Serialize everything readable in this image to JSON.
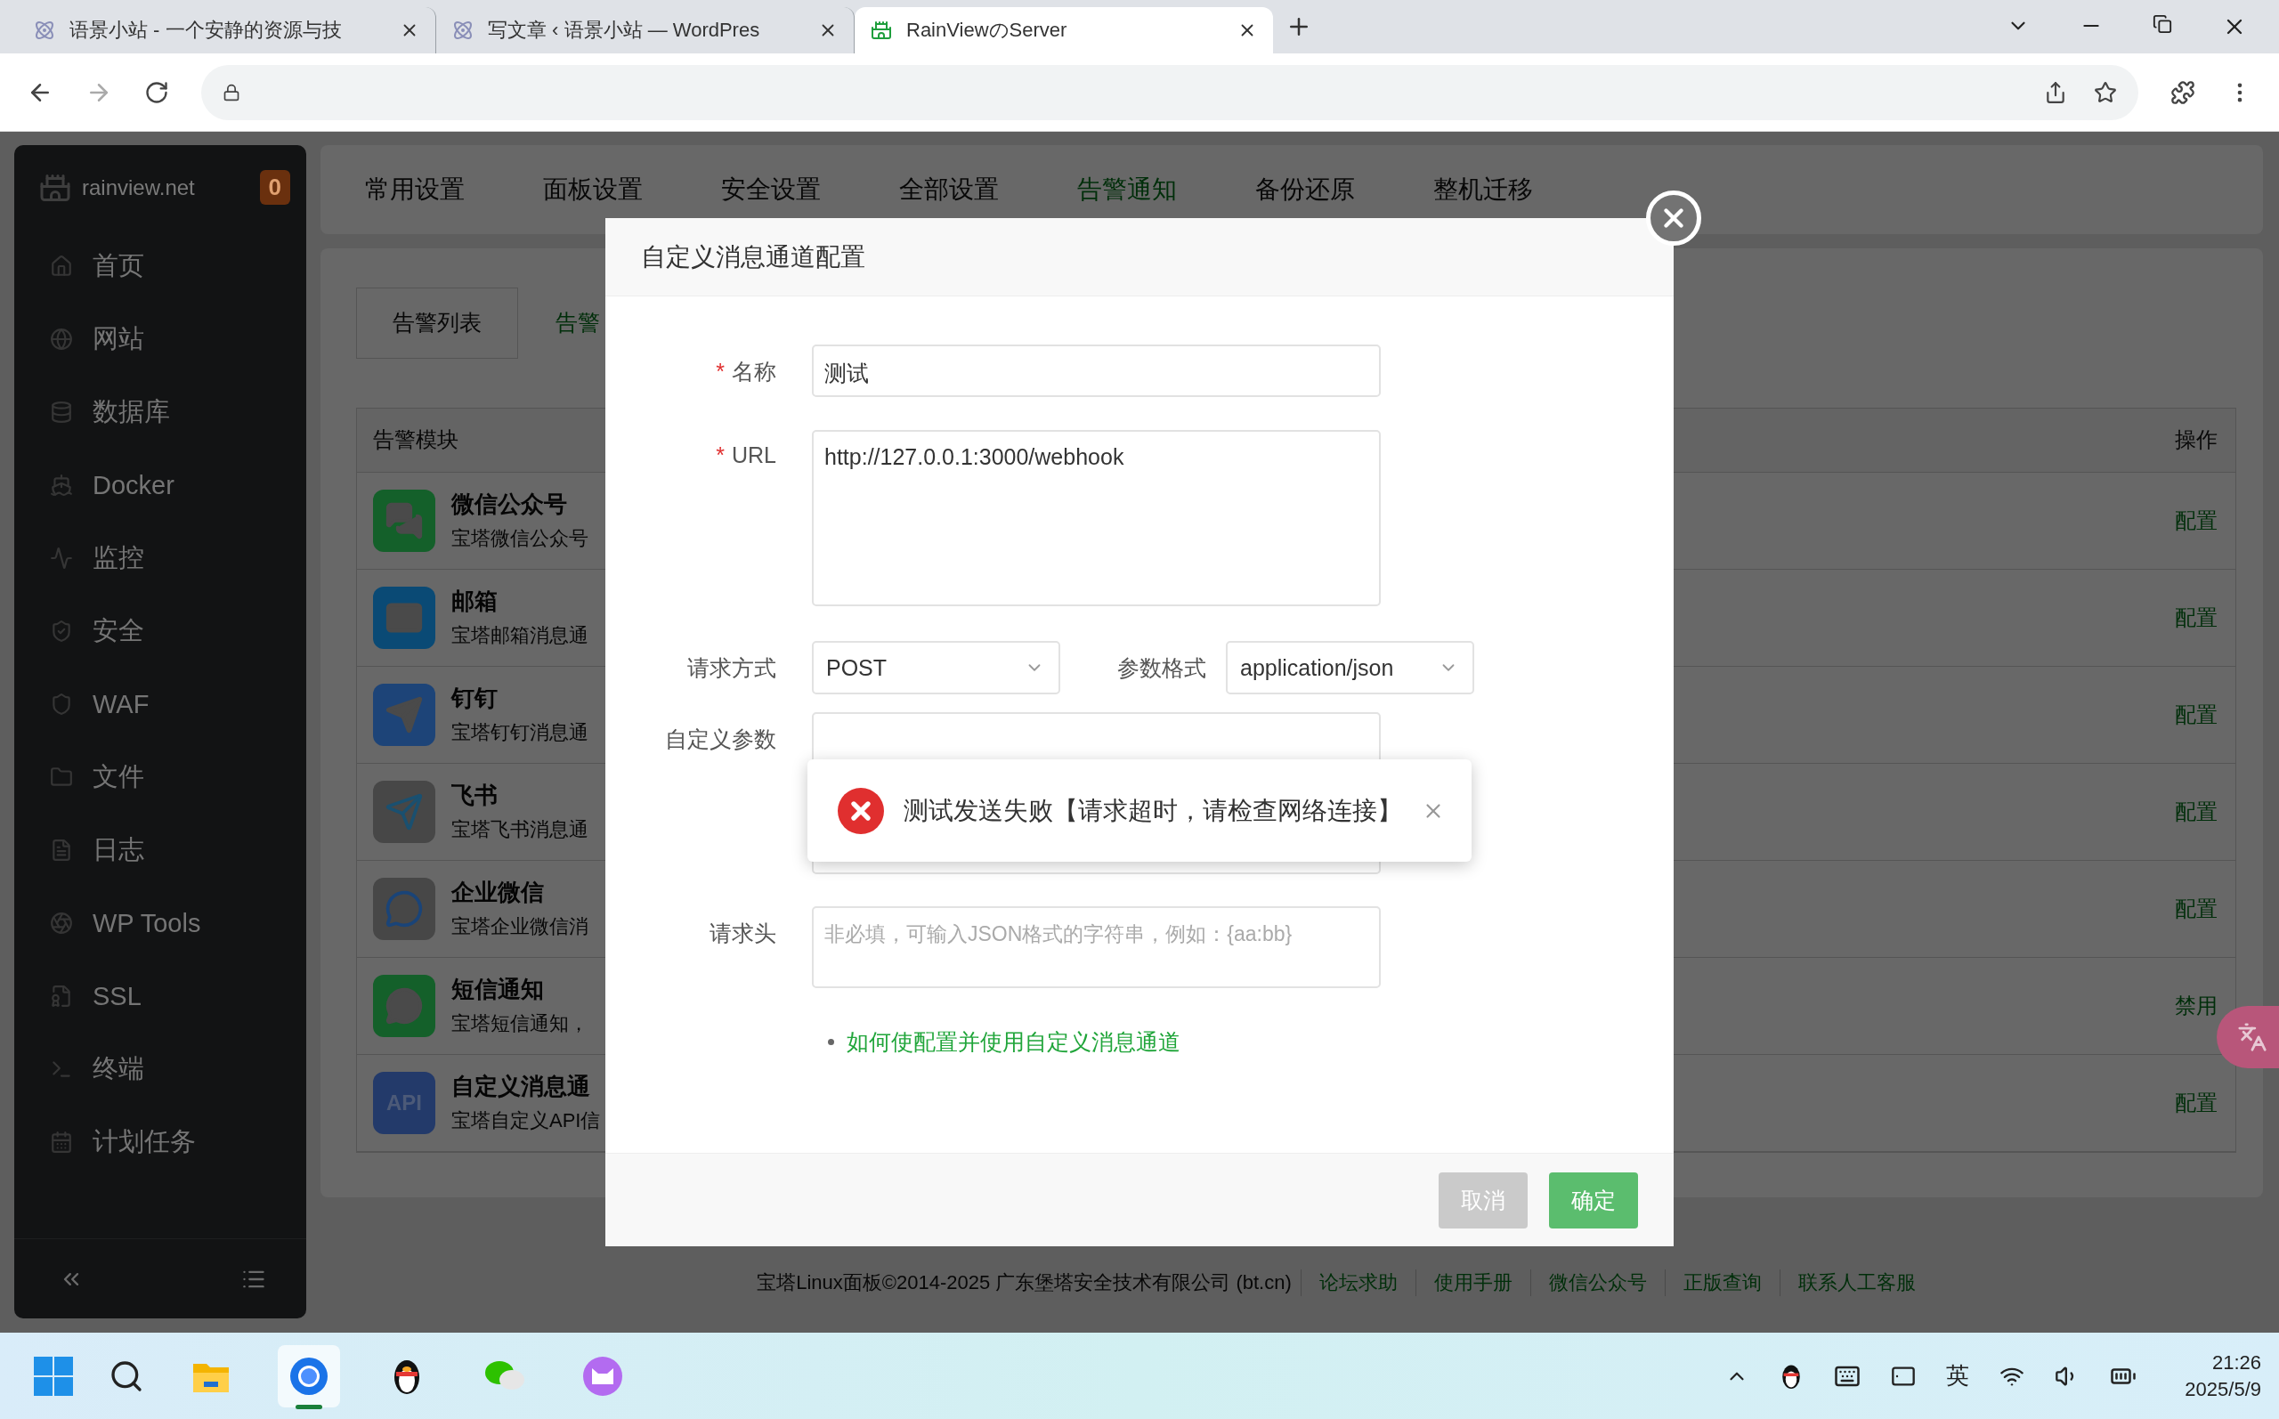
{
  "browser": {
    "tabs": [
      {
        "title": "语景小站 - 一个安静的资源与技",
        "selected": false
      },
      {
        "title": "写文章 ‹ 语景小站 — WordPres",
        "selected": false
      },
      {
        "title": "RainViewのServer",
        "selected": true
      }
    ]
  },
  "sidebar": {
    "brand": "rainview.net",
    "badge": "0",
    "items": [
      {
        "label": "首页"
      },
      {
        "label": "网站"
      },
      {
        "label": "数据库"
      },
      {
        "label": "Docker"
      },
      {
        "label": "监控"
      },
      {
        "label": "安全"
      },
      {
        "label": "WAF"
      },
      {
        "label": "文件"
      },
      {
        "label": "日志"
      },
      {
        "label": "WP Tools"
      },
      {
        "label": "SSL"
      },
      {
        "label": "终端"
      },
      {
        "label": "计划任务"
      }
    ]
  },
  "settings_tabs": [
    {
      "label": "常用设置",
      "selected": false
    },
    {
      "label": "面板设置",
      "selected": false
    },
    {
      "label": "安全设置",
      "selected": false
    },
    {
      "label": "全部设置",
      "selected": false
    },
    {
      "label": "告警通知",
      "selected": true
    },
    {
      "label": "备份还原",
      "selected": false
    },
    {
      "label": "整机迁移",
      "selected": false
    }
  ],
  "alert_tabs": [
    {
      "label": "告警列表",
      "selected": false
    },
    {
      "label": "告警",
      "selected": true
    }
  ],
  "alert_table": {
    "columns": [
      "告警模块",
      "操作"
    ],
    "rows": [
      {
        "title": "微信公众号",
        "description": "宝塔微信公众号",
        "action": "配置"
      },
      {
        "title": "邮箱",
        "description": "宝塔邮箱消息通",
        "action": "配置"
      },
      {
        "title": "钉钉",
        "description": "宝塔钉钉消息通",
        "action": "配置"
      },
      {
        "title": "飞书",
        "description": "宝塔飞书消息通",
        "action": "配置"
      },
      {
        "title": "企业微信",
        "description": "宝塔企业微信消",
        "action": "配置"
      },
      {
        "title": "短信通知",
        "description": "宝塔短信通知，",
        "action": "禁用"
      },
      {
        "title": "自定义消息通",
        "description": "宝塔自定义API信",
        "action": "配置",
        "icon_text": "API"
      }
    ]
  },
  "footer": {
    "copyright": "宝塔Linux面板©2014-2025 广东堡塔安全技术有限公司 (bt.cn)",
    "links": [
      "论坛求助",
      "使用手册",
      "微信公众号",
      "正版查询",
      "联系人工客服"
    ]
  },
  "modal": {
    "title": "自定义消息通道配置",
    "fields": [
      {
        "kind": "text",
        "label": "名称",
        "required_mark": "*",
        "value": "测试"
      },
      {
        "kind": "textarea",
        "label": "URL",
        "required_mark": "*",
        "value": "http://127.0.0.1:3000/webhook"
      },
      {
        "kind": "selects",
        "label": "请求方式",
        "value": "POST",
        "label_2": "参数格式",
        "value_2": "application/json"
      },
      {
        "kind": "textarea",
        "label": "自定义参数"
      },
      {
        "kind": "short_textarea",
        "label": "请求头",
        "placeholder": "非必填，可输入JSON格式的字符串，例如：{aa:bb}"
      }
    ],
    "help_link": "如何使配置并使用自定义消息通道",
    "buttons": [
      {
        "label": "取消",
        "kind": "cancel"
      },
      {
        "label": "确定",
        "kind": "primary"
      }
    ]
  },
  "toast": {
    "message": "测试发送失败【请求超时，请检查网络连接】"
  },
  "taskbar": {
    "apps": [
      {
        "selected": false
      },
      {
        "selected": true
      },
      {
        "selected": false
      },
      {
        "selected": false
      },
      {
        "selected": false
      }
    ],
    "ime": "英",
    "time": "21:26",
    "date": "2025/5/9"
  }
}
